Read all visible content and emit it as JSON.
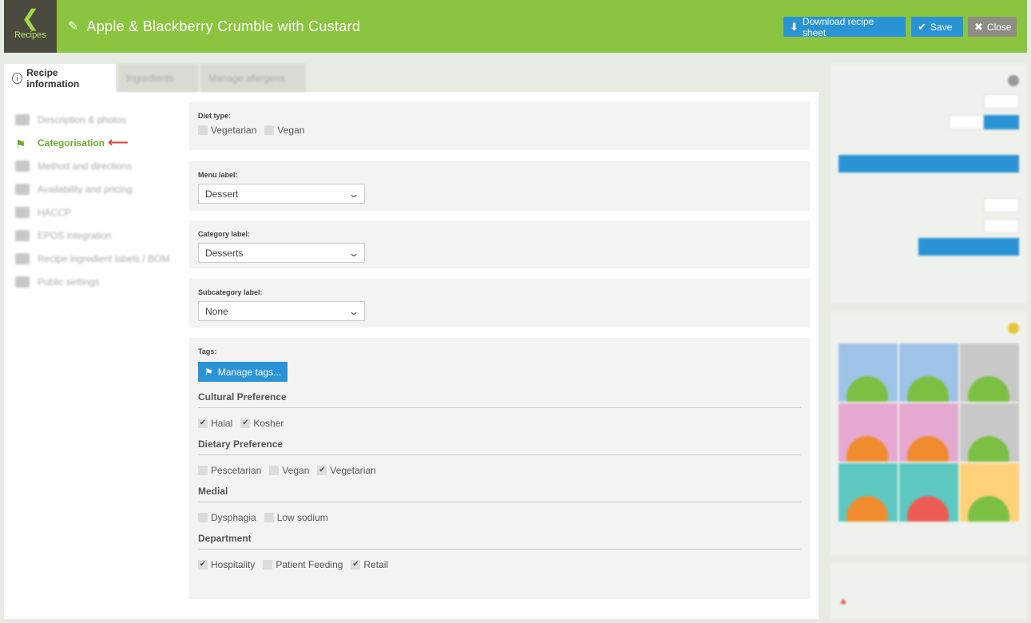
{
  "header": {
    "back_label": "Recipes",
    "title": "Apple & Blackberry Crumble with Custard",
    "download_label": "Download recipe sheet",
    "save_label": "Save",
    "close_label": "Close"
  },
  "tabs": {
    "recipe_info": "Recipe information",
    "ingredients": "Ingredients",
    "allergens": "Manage allergens"
  },
  "nav": {
    "items": [
      {
        "label": "Description & photos",
        "active": false
      },
      {
        "label": "Categorisation",
        "active": true
      },
      {
        "label": "Method and directions",
        "active": false
      },
      {
        "label": "Availability and pricing",
        "active": false
      },
      {
        "label": "HACCP",
        "active": false
      },
      {
        "label": "EPOS integration",
        "active": false
      },
      {
        "label": "Recipe ingredient labels / BOM",
        "active": false
      },
      {
        "label": "Public settings",
        "active": false
      }
    ]
  },
  "diet_type": {
    "label": "Diet type:",
    "options": [
      {
        "label": "Vegetarian",
        "checked": false
      },
      {
        "label": "Vegan",
        "checked": false
      }
    ]
  },
  "menu_label": {
    "label": "Menu label:",
    "value": "Dessert"
  },
  "category_label": {
    "label": "Category label:",
    "value": "Desserts"
  },
  "subcategory_label": {
    "label": "Subcategory label:",
    "value": "None"
  },
  "tags": {
    "label": "Tags:",
    "manage_label": "Manage tags...",
    "groups": [
      {
        "title": "Cultural Preference",
        "options": [
          {
            "label": "Halal",
            "checked": true
          },
          {
            "label": "Kosher",
            "checked": true
          }
        ]
      },
      {
        "title": "Dietary Preference",
        "options": [
          {
            "label": "Pescetarian",
            "checked": false
          },
          {
            "label": "Vegan",
            "checked": false
          },
          {
            "label": "Vegetarian",
            "checked": true
          }
        ]
      },
      {
        "title": "Medial",
        "options": [
          {
            "label": "Dysphagia",
            "checked": false
          },
          {
            "label": "Low sodium",
            "checked": false
          }
        ]
      },
      {
        "title": "Department",
        "options": [
          {
            "label": "Hospitality",
            "checked": true
          },
          {
            "label": "Patient Feeding",
            "checked": false
          },
          {
            "label": "Retail",
            "checked": true
          }
        ]
      }
    ]
  },
  "colors": {
    "brand_green": "#8bc53f",
    "action_blue": "#2a93d5",
    "close_gray": "#8d8d85",
    "active_nav": "#6daa2b",
    "arrow_red": "#e0463a"
  }
}
